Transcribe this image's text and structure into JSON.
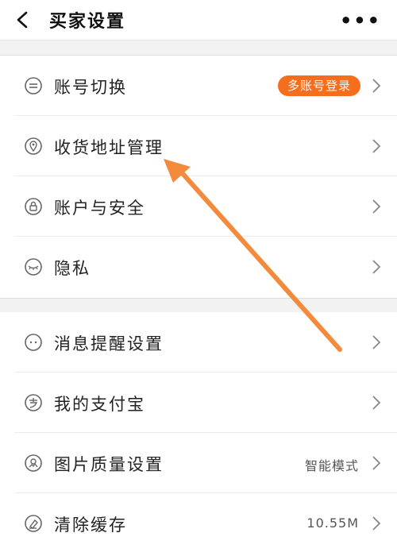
{
  "header": {
    "title": "买家设置",
    "more": "•••"
  },
  "section1": [
    {
      "label": "账号切换",
      "badge": "多账号登录",
      "icon": "switch-icon"
    },
    {
      "label": "收货地址管理",
      "icon": "location-pin-icon"
    },
    {
      "label": "账户与安全",
      "icon": "lock-icon"
    },
    {
      "label": "隐私",
      "icon": "eye-closed-icon"
    }
  ],
  "section2": [
    {
      "label": "消息提醒设置",
      "icon": "message-icon"
    },
    {
      "label": "我的支付宝",
      "icon": "alipay-icon"
    },
    {
      "label": "图片质量设置",
      "value": "智能模式",
      "icon": "image-quality-icon"
    },
    {
      "label": "清除缓存",
      "value": "10.55M",
      "icon": "clear-cache-icon"
    }
  ],
  "colors": {
    "accent": "#f46e1d",
    "annotation_arrow": "#f48a3c"
  }
}
